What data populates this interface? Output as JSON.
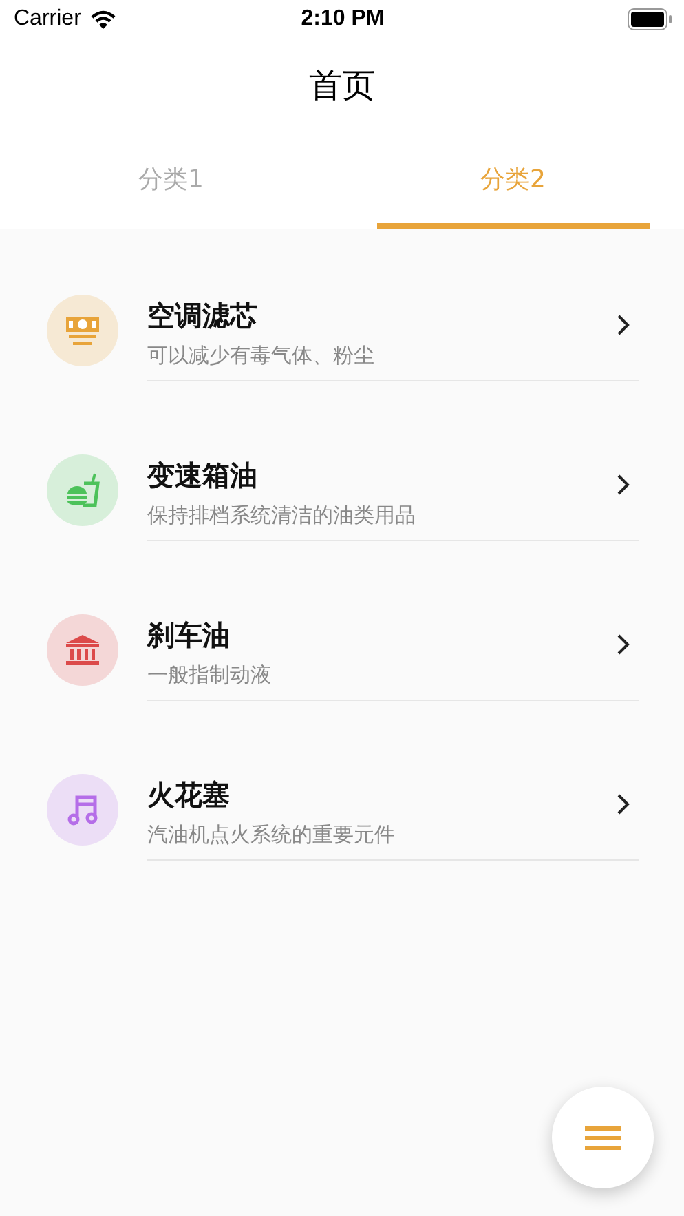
{
  "status_bar": {
    "carrier": "Carrier",
    "time": "2:10 PM"
  },
  "title": "首页",
  "tabs": [
    {
      "label": "分类1",
      "selected": false
    },
    {
      "label": "分类2",
      "selected": true
    }
  ],
  "items": [
    {
      "kind": "money",
      "color": "#e8a43a",
      "title": "空调滤芯",
      "subtitle": "可以减少有毒气体、粉尘"
    },
    {
      "kind": "food",
      "color": "#4cc25a",
      "title": "变速箱油",
      "subtitle": "保持排档系统清洁的油类用品"
    },
    {
      "kind": "bank",
      "color": "#dc4a4a",
      "title": "刹车油",
      "subtitle": "一般指制动液"
    },
    {
      "kind": "music",
      "color": "#b56ee8",
      "title": "火花塞",
      "subtitle": "汽油机点火系统的重要元件"
    }
  ]
}
